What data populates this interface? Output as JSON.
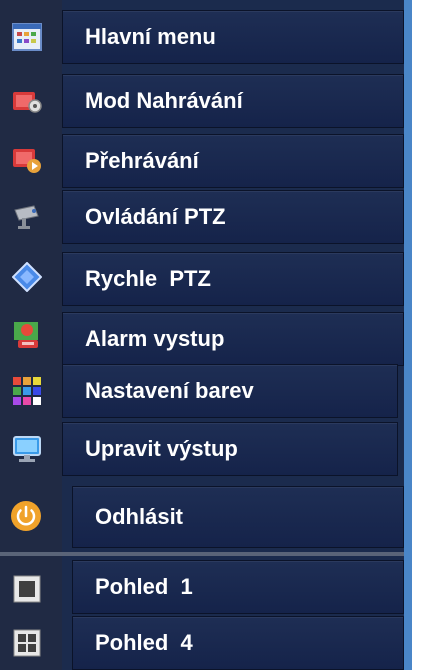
{
  "menu": {
    "items": [
      {
        "label": "Hlavní menu",
        "icon": "main-menu-grid-icon"
      },
      {
        "label": "Mod Nahrávání",
        "icon": "record-mode-icon"
      },
      {
        "label": "Přehrávání",
        "icon": "playback-icon"
      },
      {
        "label": "Ovládání PTZ",
        "icon": "ptz-camera-icon"
      },
      {
        "label": "Rychle  PTZ",
        "icon": "quick-ptz-diamond-icon"
      },
      {
        "label": "Alarm vystup",
        "icon": "alarm-output-icon"
      },
      {
        "label": "Nastavení barev",
        "icon": "color-settings-icon"
      },
      {
        "label": "Upravit výstup",
        "icon": "adjust-output-monitor-icon"
      },
      {
        "label": "Odhlásit",
        "icon": "logout-power-icon"
      },
      {
        "label": "Pohled  1",
        "icon": "view-single-icon"
      },
      {
        "label": "Pohled  4",
        "icon": "view-quad-icon"
      }
    ]
  },
  "colors": {
    "panel_background": "#1b2b4d",
    "item_background": "#1e2e54",
    "text": "#ffffff",
    "right_edge_accent": "#4a86c8",
    "separator": "#5a6478"
  }
}
